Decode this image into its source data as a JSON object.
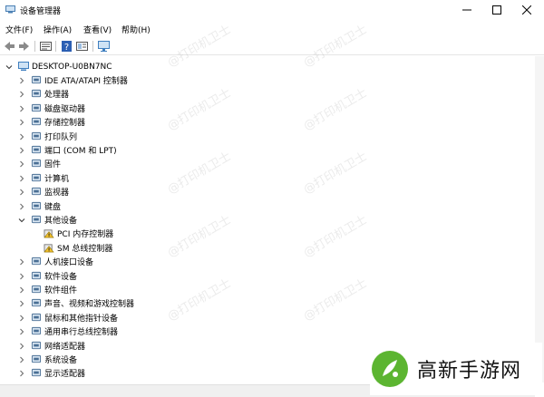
{
  "window": {
    "title": "设备管理器",
    "icon": "device-manager-icon"
  },
  "menu": [
    "文件(F)",
    "操作(A)",
    "查看(V)",
    "帮助(H)"
  ],
  "toolbar_icons": [
    "back-arrow-icon",
    "forward-arrow-icon",
    "properties-icon",
    "help-icon",
    "view-icon",
    "monitor-scan-icon"
  ],
  "tree": {
    "root": "DESKTOP-U0BN7NC",
    "items": [
      {
        "label": "IDE ATA/ATAPI 控制器",
        "icon": "ide-controller-icon"
      },
      {
        "label": "处理器",
        "icon": "processor-icon"
      },
      {
        "label": "磁盘驱动器",
        "icon": "disk-drive-icon"
      },
      {
        "label": "存储控制器",
        "icon": "storage-controller-icon"
      },
      {
        "label": "打印队列",
        "icon": "printer-icon"
      },
      {
        "label": "端口 (COM 和 LPT)",
        "icon": "port-icon"
      },
      {
        "label": "固件",
        "icon": "firmware-icon"
      },
      {
        "label": "计算机",
        "icon": "computer-icon"
      },
      {
        "label": "监视器",
        "icon": "monitor-icon"
      },
      {
        "label": "键盘",
        "icon": "keyboard-icon"
      },
      {
        "label": "其他设备",
        "icon": "other-devices-icon",
        "expanded": true,
        "children": [
          {
            "label": "PCI 内存控制器",
            "icon": "warning-device-icon"
          },
          {
            "label": "SM 总线控制器",
            "icon": "warning-device-icon"
          }
        ]
      },
      {
        "label": "人机接口设备",
        "icon": "hid-icon"
      },
      {
        "label": "软件设备",
        "icon": "software-device-icon"
      },
      {
        "label": "软件组件",
        "icon": "software-component-icon"
      },
      {
        "label": "声音、视频和游戏控制器",
        "icon": "sound-icon"
      },
      {
        "label": "鼠标和其他指针设备",
        "icon": "mouse-icon"
      },
      {
        "label": "通用串行总线控制器",
        "icon": "usb-icon"
      },
      {
        "label": "网络适配器",
        "icon": "network-adapter-icon"
      },
      {
        "label": "系统设备",
        "icon": "system-device-icon"
      },
      {
        "label": "显示适配器",
        "icon": "display-adapter-icon"
      }
    ]
  },
  "watermark": "@打印机卫士",
  "brand": {
    "text": "高新手游网",
    "icon": "brand-logo-icon",
    "color": "#5cb531"
  },
  "colors": {
    "warning": "#f2c12e",
    "device_blue": "#3f7fbf"
  }
}
